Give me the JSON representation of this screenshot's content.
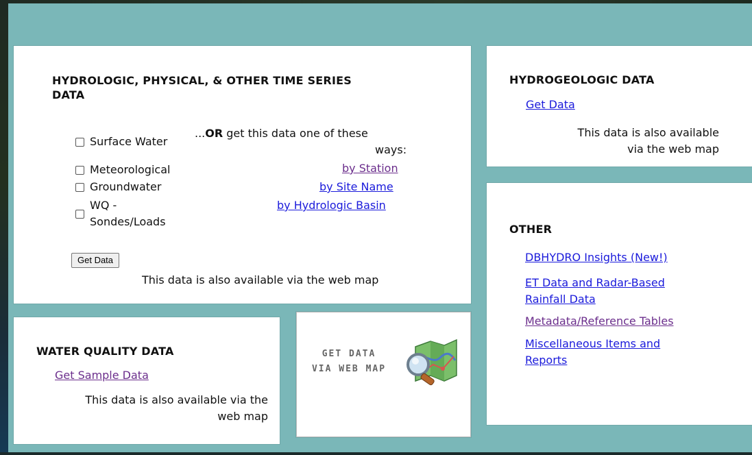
{
  "hydro": {
    "heading_line1": "HYDROLOGIC, PHYSICAL, & OTHER TIME SERIES",
    "heading_line2": "DATA",
    "checkboxes": [
      "Surface Water",
      "Meteorological",
      "Groundwater",
      "WQ -",
      "Sondes/Loads"
    ],
    "or_prefix": "...",
    "or_bold": "OR",
    "or_rest": " get this data one of these",
    "or_line2": "ways:",
    "links": [
      "by Station",
      "by Site Name",
      "by Hydrologic Basin"
    ],
    "button_label": "Get Data",
    "also_available": "This data is also available via the web map"
  },
  "hydrogeo": {
    "heading": "HYDROGEOLOGIC DATA",
    "link": "Get Data",
    "also_line1": "This data is also available",
    "also_line2": "via the web map"
  },
  "other": {
    "heading": "OTHER",
    "link1": "DBHYDRO Insights (New!)",
    "link2_line1": "ET Data and Radar-Based",
    "link2_line2": "Rainfall Data",
    "link3": "Metadata/Reference Tables",
    "link4_line1": "Miscellaneous Items and",
    "link4_line2": "Reports"
  },
  "wq": {
    "heading": "WATER QUALITY DATA",
    "link": "Get Sample Data",
    "also_line1": "This data is also available via the",
    "also_line2": "web map"
  },
  "webmap": {
    "line1": "GET DATA",
    "line2": "VIA WEB MAP",
    "icon": "map-magnifier-icon"
  },
  "colors": {
    "background": "#7ab7b8",
    "link": "#1a1adb",
    "visited_link": "#6b2e8c"
  }
}
